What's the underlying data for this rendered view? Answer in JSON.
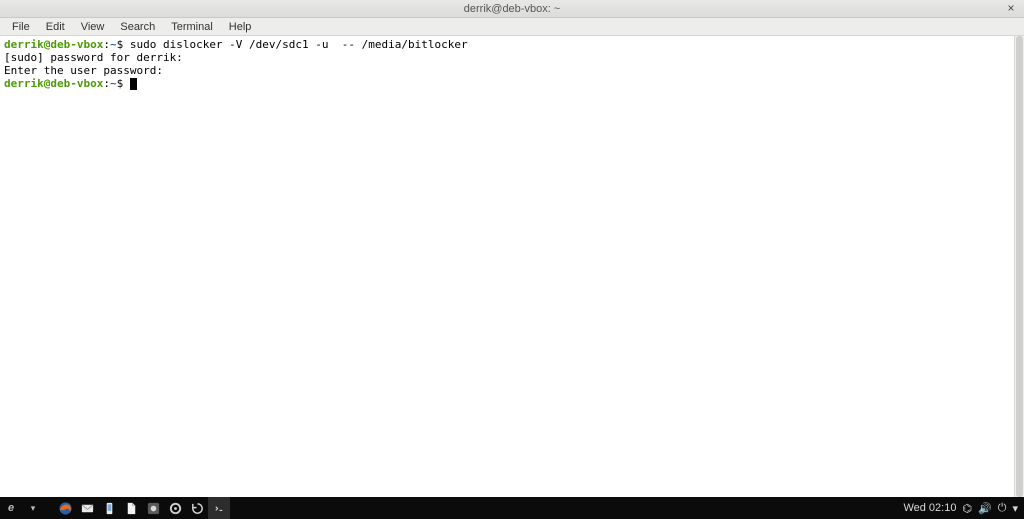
{
  "window": {
    "title": "derrik@deb-vbox: ~",
    "close_glyph": "×",
    "menu": [
      "File",
      "Edit",
      "View",
      "Search",
      "Terminal",
      "Help"
    ]
  },
  "prompt": {
    "user_host": "derrik@deb-vbox",
    "sep1": ":",
    "path": "~",
    "sigil": "$"
  },
  "terminal_lines": {
    "cmd1": "sudo dislocker -V /dev/sdc1 -u  -- /media/bitlocker",
    "sudo_prompt": "[sudo] password for derrik:",
    "user_pw_prompt": "Enter the user password:"
  },
  "panel": {
    "menu_glyph": "e",
    "arrow_glyph": "▾",
    "clock": "Wed 02:10",
    "tray": {
      "network_glyph": "⌬",
      "sound_glyph": "🔊",
      "power_glyph": "⏻",
      "session_glyph": "▾"
    }
  },
  "colors": {
    "user_host": "#4e9a06",
    "path": "#3465a4"
  }
}
